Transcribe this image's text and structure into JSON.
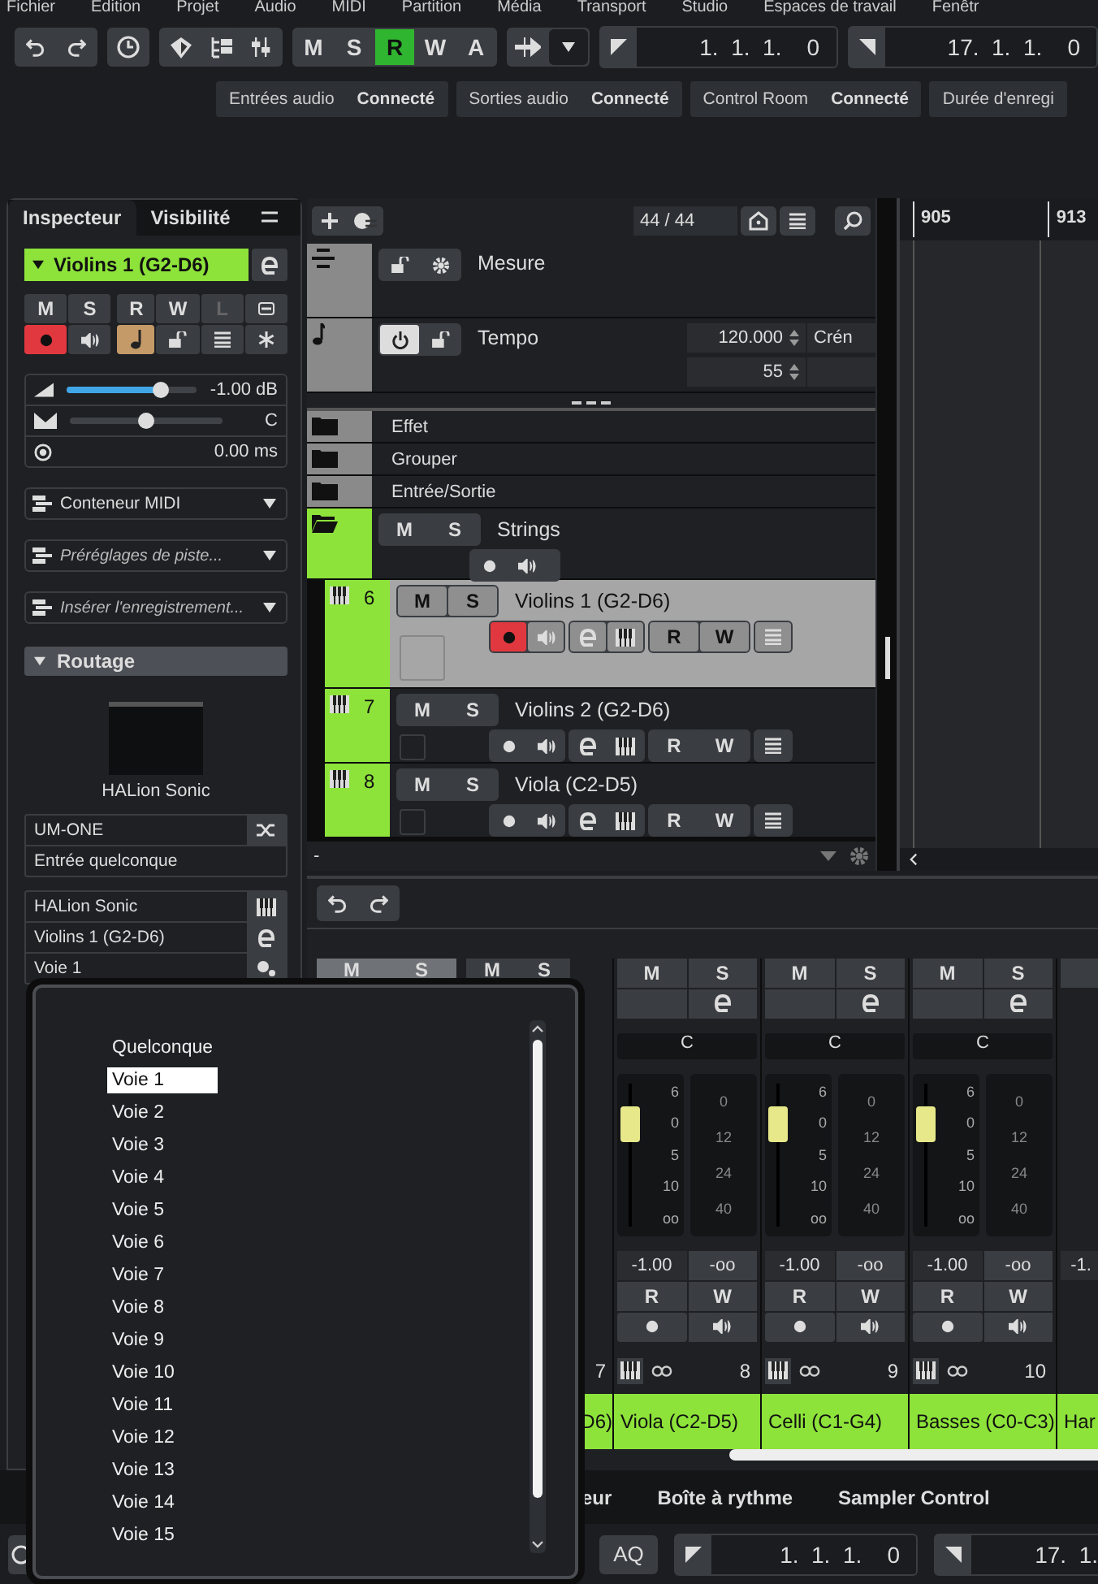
{
  "menu_bar": [
    "Fichier",
    "Edition",
    "Projet",
    "Audio",
    "MIDI",
    "Partition",
    "Média",
    "Transport",
    "Studio",
    "Espaces de travail",
    "Fenêtr"
  ],
  "toolbar": {
    "automation": [
      {
        "label": "M",
        "on": false
      },
      {
        "label": "S",
        "on": false
      },
      {
        "label": "R",
        "on": true
      },
      {
        "label": "W",
        "on": false
      },
      {
        "label": "A",
        "on": false
      }
    ],
    "left_locator": "1.  1.  1.    0",
    "right_locator": "17.  1.  1.    0"
  },
  "connections": [
    {
      "label": "Entrées audio",
      "status": "Connecté"
    },
    {
      "label": "Sorties audio",
      "status": "Connecté"
    },
    {
      "label": "Control Room",
      "status": "Connecté"
    },
    {
      "label": "Durée d'enregi"
    }
  ],
  "inspector": {
    "tabs": [
      {
        "label": "Inspecteur",
        "selected": true
      },
      {
        "label": "Visibilité",
        "selected": false
      }
    ],
    "track_name": "Violins 1 (G2-D6)",
    "buttons": [
      {
        "label": "M",
        "disabled": false
      },
      {
        "label": "S",
        "disabled": false
      },
      {
        "label": "R",
        "disabled": false
      },
      {
        "label": "W",
        "disabled": false
      },
      {
        "label": "L",
        "disabled": true
      }
    ],
    "icon_buttons": [
      {
        "kind": "record",
        "on": true
      },
      {
        "kind": "monitor",
        "on": false
      },
      {
        "kind": "note",
        "on": true
      },
      {
        "kind": "lock",
        "on": false
      },
      {
        "kind": "list",
        "on": false
      },
      {
        "kind": "asterisk",
        "on": false
      }
    ],
    "volume": {
      "level": 0.72,
      "reading": "-1.00 dB"
    },
    "pan": {
      "level": 0.5,
      "reading": "C"
    },
    "delay": {
      "reading": "0.00 ms"
    },
    "dropdowns": [
      {
        "value": "Conteneur MIDI"
      },
      {
        "placeholder": "Préréglages de piste..."
      },
      {
        "placeholder": "Insérer l'enregistrement..."
      }
    ],
    "routing": {
      "title": "Routage",
      "expanded": true,
      "instrument": "HALion Sonic",
      "input": "UM-ONE",
      "input_channel": "Entrée quelconque",
      "output": "HALion Sonic",
      "output_track": "Violins 1 (G2-D6)",
      "channel": "Voie 1"
    }
  },
  "project": {
    "track_count": "44 / 44",
    "tracks": [
      {
        "kind": "signature",
        "name": "Mesure",
        "color": "#8a8a8a"
      },
      {
        "kind": "tempo",
        "name": "Tempo",
        "color": "#8a8a8a",
        "tempo": "120.000",
        "value": "55",
        "mode": "Crén",
        "on": true
      },
      {
        "kind": "folder",
        "name": "Effet",
        "color": "#8a8a8a",
        "open": false
      },
      {
        "kind": "folder",
        "name": "Grouper",
        "color": "#8a8a8a",
        "open": false
      },
      {
        "kind": "folder",
        "name": "Entrée/Sortie",
        "color": "#8a8a8a",
        "open": false
      },
      {
        "kind": "group",
        "name": "Strings",
        "color": "#8de33a",
        "open": true,
        "buttons": [
          "M",
          "S"
        ]
      },
      {
        "kind": "instrument",
        "number": "6",
        "name": "Violins 1 (G2-D6)",
        "color": "#8de33a",
        "selected": true,
        "record": true,
        "buttons": [
          "M",
          "S",
          "R",
          "W"
        ]
      },
      {
        "kind": "instrument",
        "number": "7",
        "name": "Violins 2 (G2-D6)",
        "color": "#8de33a",
        "selected": false,
        "record": false,
        "buttons": [
          "M",
          "S",
          "R",
          "W"
        ]
      },
      {
        "kind": "instrument",
        "number": "8",
        "name": "Viola (C2-D5)",
        "color": "#8de33a",
        "selected": false,
        "record": false,
        "buttons": [
          "M",
          "S",
          "R",
          "W"
        ]
      }
    ],
    "footer": "-"
  },
  "ruler": [
    "905",
    "913"
  ],
  "mixer": {
    "covered_headers": [
      {
        "mute": "M",
        "solo": "S",
        "selected": true
      },
      {
        "mute": "M",
        "solo": "S",
        "selected": false
      }
    ],
    "covered_channel": {
      "number": "7",
      "name": "D6)",
      "color": "#8de33a"
    },
    "channels": [
      {
        "number": "8",
        "name": "Viola (C2-D5)",
        "color": "#8de33a",
        "buttons": [
          "M",
          "S",
          "R",
          "W"
        ],
        "pan": "C",
        "volume": "-1.00",
        "peak": "-oo",
        "level": 0.72,
        "fader_scale": [
          "6",
          "0",
          "5",
          "10",
          "oo"
        ],
        "meter_scale": [
          "0",
          "12",
          "24",
          "40"
        ]
      },
      {
        "number": "9",
        "name": "Celli (C1-G4)",
        "color": "#8de33a",
        "buttons": [
          "M",
          "S",
          "R",
          "W"
        ],
        "pan": "C",
        "volume": "-1.00",
        "peak": "-oo",
        "level": 0.72,
        "fader_scale": [
          "6",
          "0",
          "5",
          "10",
          "oo"
        ],
        "meter_scale": [
          "0",
          "12",
          "24",
          "40"
        ]
      },
      {
        "number": "10",
        "name": "Basses (C0-C3)",
        "color": "#8de33a",
        "buttons": [
          "M",
          "S",
          "R",
          "W"
        ],
        "pan": "C",
        "volume": "-1.00",
        "peak": "-oo",
        "level": 0.72,
        "fader_scale": [
          "6",
          "0",
          "5",
          "10",
          "oo"
        ],
        "meter_scale": [
          "0",
          "12",
          "24",
          "40"
        ]
      }
    ],
    "partial_channel": {
      "name": "Har",
      "volume": "-1.",
      "color": "#8de33a"
    }
  },
  "popup": {
    "items": [
      {
        "label": "Quelconque",
        "selected": false
      },
      {
        "label": "Voie 1",
        "selected": true
      },
      {
        "label": "Voie 2",
        "selected": false
      },
      {
        "label": "Voie 3",
        "selected": false
      },
      {
        "label": "Voie 4",
        "selected": false
      },
      {
        "label": "Voie 5",
        "selected": false
      },
      {
        "label": "Voie 6",
        "selected": false
      },
      {
        "label": "Voie 7",
        "selected": false
      },
      {
        "label": "Voie 8",
        "selected": false
      },
      {
        "label": "Voie 9",
        "selected": false
      },
      {
        "label": "Voie 10",
        "selected": false
      },
      {
        "label": "Voie 11",
        "selected": false
      },
      {
        "label": "Voie 12",
        "selected": false
      },
      {
        "label": "Voie 13",
        "selected": false
      },
      {
        "label": "Voie 14",
        "selected": false
      },
      {
        "label": "Voie 15",
        "selected": false
      }
    ]
  },
  "bottom_tabs": [
    "eur",
    "Boîte à rythme",
    "Sampler Control"
  ],
  "transport": {
    "quantize": "AQ",
    "left_locator": "1.  1.  1.    0",
    "right_locator": "17.  1."
  }
}
